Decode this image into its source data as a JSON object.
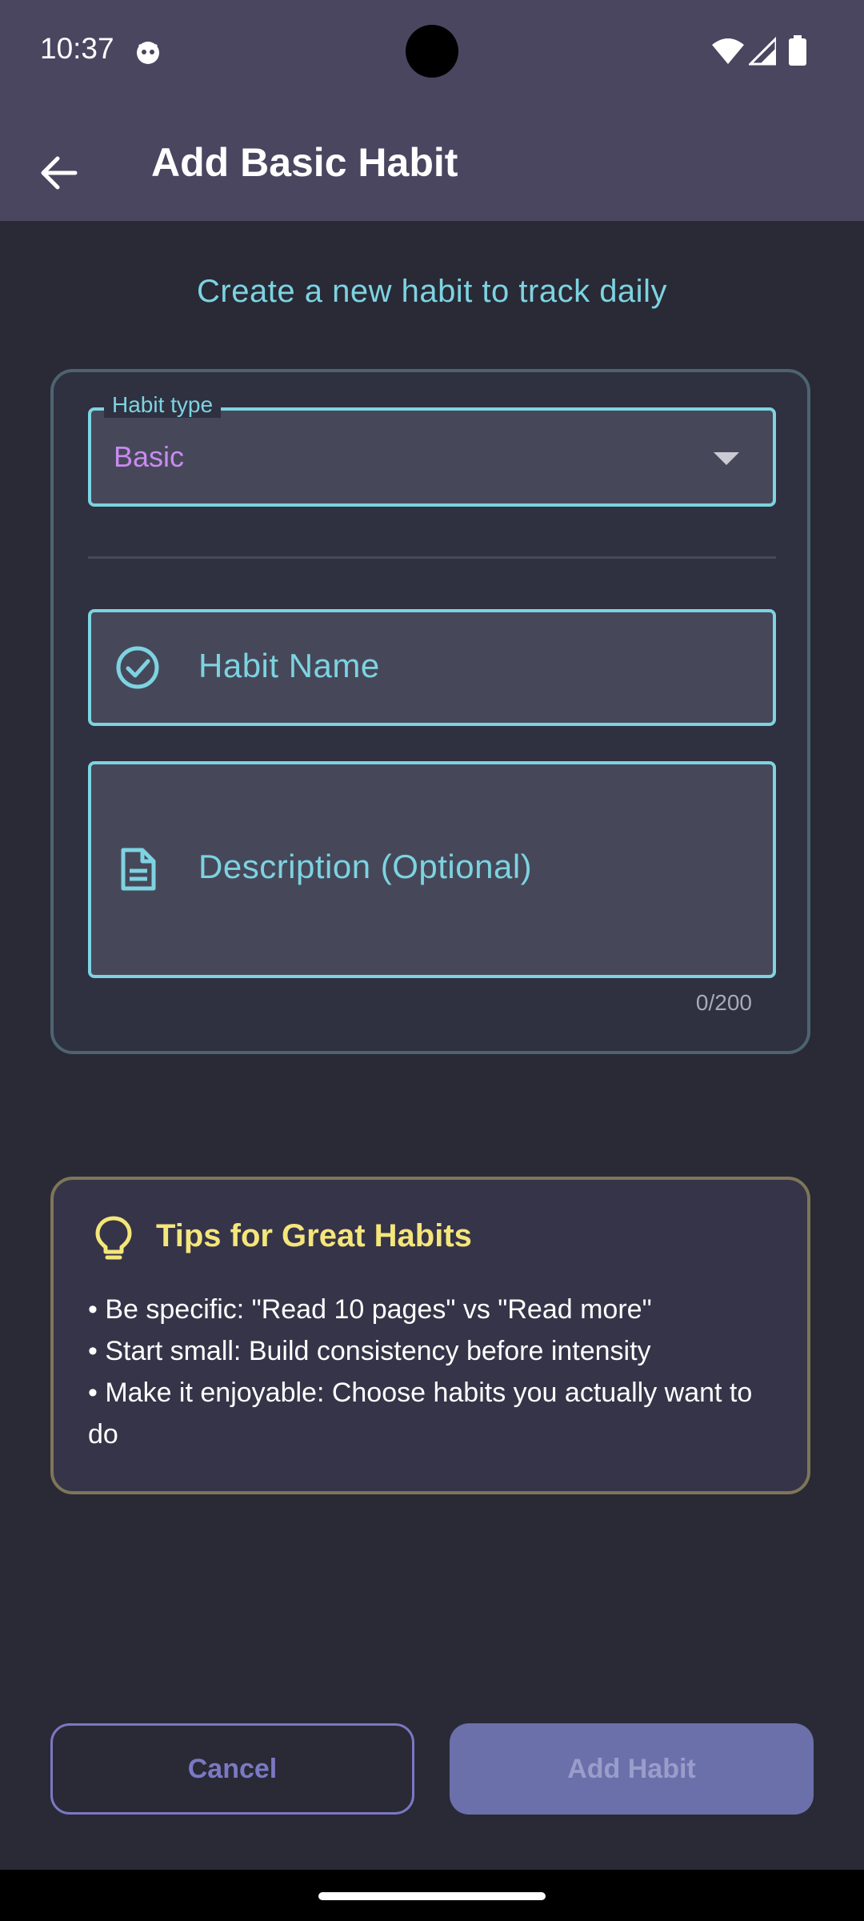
{
  "status_bar": {
    "time": "10:37",
    "icons": [
      "app-notification-icon",
      "wifi-icon",
      "signal-icon",
      "battery-icon"
    ]
  },
  "app_bar": {
    "title": "Add Basic Habit",
    "back_icon": "arrow-left-icon"
  },
  "subtitle": "Create a new habit to track daily",
  "form": {
    "habit_type": {
      "label": "Habit type",
      "value": "Basic",
      "icon": "chevron-down-icon"
    },
    "habit_name": {
      "placeholder": "Habit Name",
      "icon": "check-circle-icon"
    },
    "description": {
      "placeholder": "Description (Optional)",
      "icon": "document-icon",
      "counter": "0/200"
    }
  },
  "tips": {
    "title": "Tips for Great Habits",
    "icon": "lightbulb-icon",
    "items": [
      "• Be specific: \"Read 10 pages\" vs \"Read more\"",
      "• Start small: Build consistency before intensity",
      "• Make it enjoyable: Choose habits you actually want to do"
    ]
  },
  "actions": {
    "cancel_label": "Cancel",
    "add_label": "Add Habit"
  },
  "colors": {
    "background": "#292a36",
    "app_bar": "#4a4660",
    "accent_cyan": "#7dd3e1",
    "accent_purple": "#c98af0",
    "tips_yellow": "#f4e67a",
    "button_primary": "#6b70ab",
    "button_outline": "#7b78c4"
  }
}
